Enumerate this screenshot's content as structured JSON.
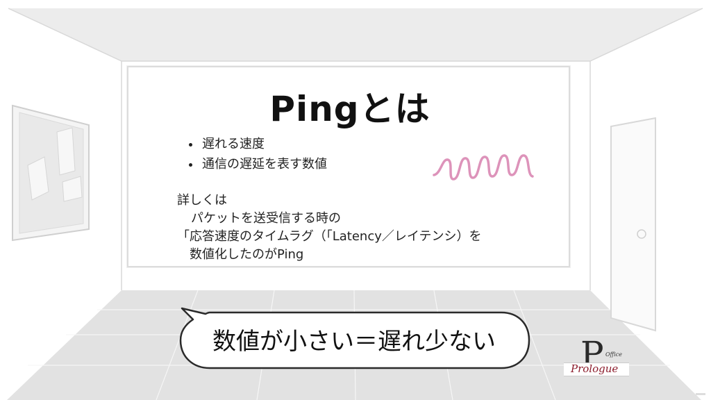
{
  "board": {
    "title": "Pingとは",
    "bullets": [
      "遅れる速度",
      "通信の遅延を表す数値"
    ],
    "detail_lines": [
      "詳しくは",
      "パケットを送受信する時の",
      "「応答速度のタイムラグ（「Latency／レイテンシ）を",
      "数値化したのがPing"
    ]
  },
  "bubble": {
    "text": "数値が小さい＝遅れ少ない"
  },
  "logo": {
    "letter": "P",
    "office": "Office",
    "name": "Prologue"
  },
  "colors": {
    "swirl": "#d987b3",
    "logo_name": "#8c1c2c"
  }
}
